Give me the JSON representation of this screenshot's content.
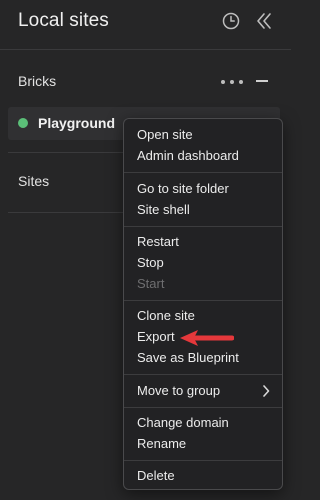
{
  "header": {
    "title": "Local sites",
    "clock_icon": "clock-icon",
    "collapse_icon": "double-chevron-left-icon"
  },
  "group": {
    "name": "Bricks"
  },
  "site": {
    "name": "Playground",
    "status_color": "#5bbf78"
  },
  "section": {
    "sites_label": "Sites"
  },
  "context_menu": {
    "open_site": "Open site",
    "admin_dashboard": "Admin dashboard",
    "go_to_site_folder": "Go to site folder",
    "site_shell": "Site shell",
    "restart": "Restart",
    "stop": "Stop",
    "start": "Start",
    "clone_site": "Clone site",
    "export": "Export",
    "save_as_blueprint": "Save as Blueprint",
    "move_to_group": "Move to group",
    "change_domain": "Change domain",
    "rename": "Rename",
    "delete": "Delete"
  },
  "annotation": {
    "arrow_color": "#e5383b"
  }
}
